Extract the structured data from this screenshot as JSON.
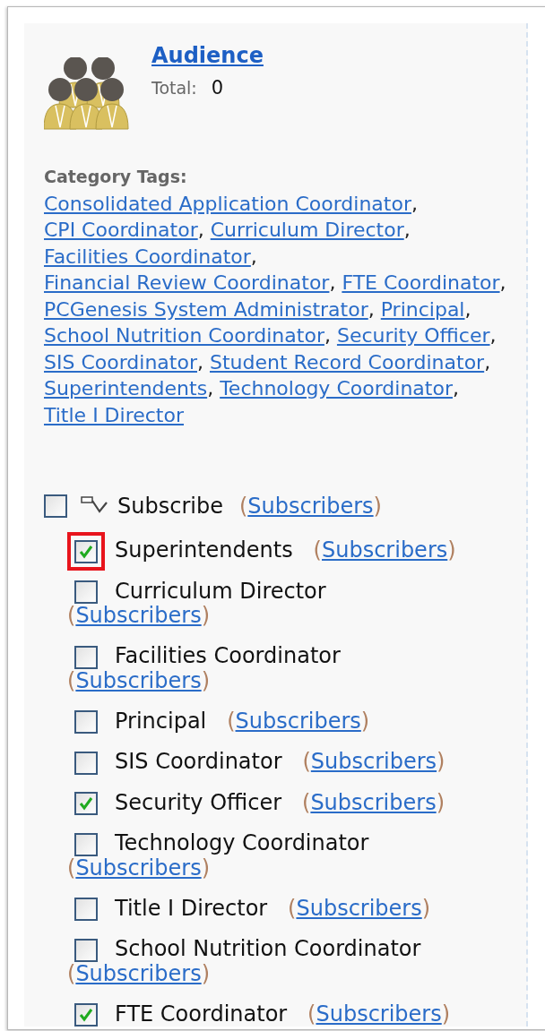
{
  "audience": {
    "title": "Audience",
    "total_label": "Total:",
    "total_value": "0"
  },
  "category_tags": {
    "label": "Category Tags:",
    "separator": ",",
    "tags": [
      "Consolidated Application Coordinator",
      "CPI Coordinator",
      "Curriculum Director",
      "Facilities Coordinator",
      "Financial Review Coordinator",
      "FTE Coordinator",
      "PCGenesis System Administrator",
      "Principal",
      "School Nutrition Coordinator",
      "Security Officer",
      "SIS Coordinator",
      "Student Record Coordinator",
      "Superintendents",
      "Technology Coordinator",
      "Title I Director"
    ]
  },
  "subscribe": {
    "label": "Subscribe",
    "checked": false,
    "link": "(Subscribers)"
  },
  "items": [
    {
      "label": "Superintendents",
      "checked": true,
      "highlighted": true,
      "link": "(Subscribers)"
    },
    {
      "label": "Curriculum Director",
      "checked": false,
      "highlighted": false,
      "link": "(Subscribers)"
    },
    {
      "label": "Facilities Coordinator",
      "checked": false,
      "highlighted": false,
      "link": "(Subscribers)"
    },
    {
      "label": "Principal",
      "checked": false,
      "highlighted": false,
      "link": "(Subscribers)"
    },
    {
      "label": "SIS Coordinator",
      "checked": false,
      "highlighted": false,
      "link": "(Subscribers)"
    },
    {
      "label": "Security Officer",
      "checked": true,
      "highlighted": false,
      "link": "(Subscribers)"
    },
    {
      "label": "Technology Coordinator",
      "checked": false,
      "highlighted": false,
      "link": "(Subscribers)"
    },
    {
      "label": "Title I Director",
      "checked": false,
      "highlighted": false,
      "link": "(Subscribers)"
    },
    {
      "label": "School Nutrition Coordinator",
      "checked": false,
      "highlighted": false,
      "link": "(Subscribers)"
    },
    {
      "label": "FTE Coordinator",
      "checked": true,
      "highlighted": false,
      "link": "(Subscribers)"
    }
  ]
}
